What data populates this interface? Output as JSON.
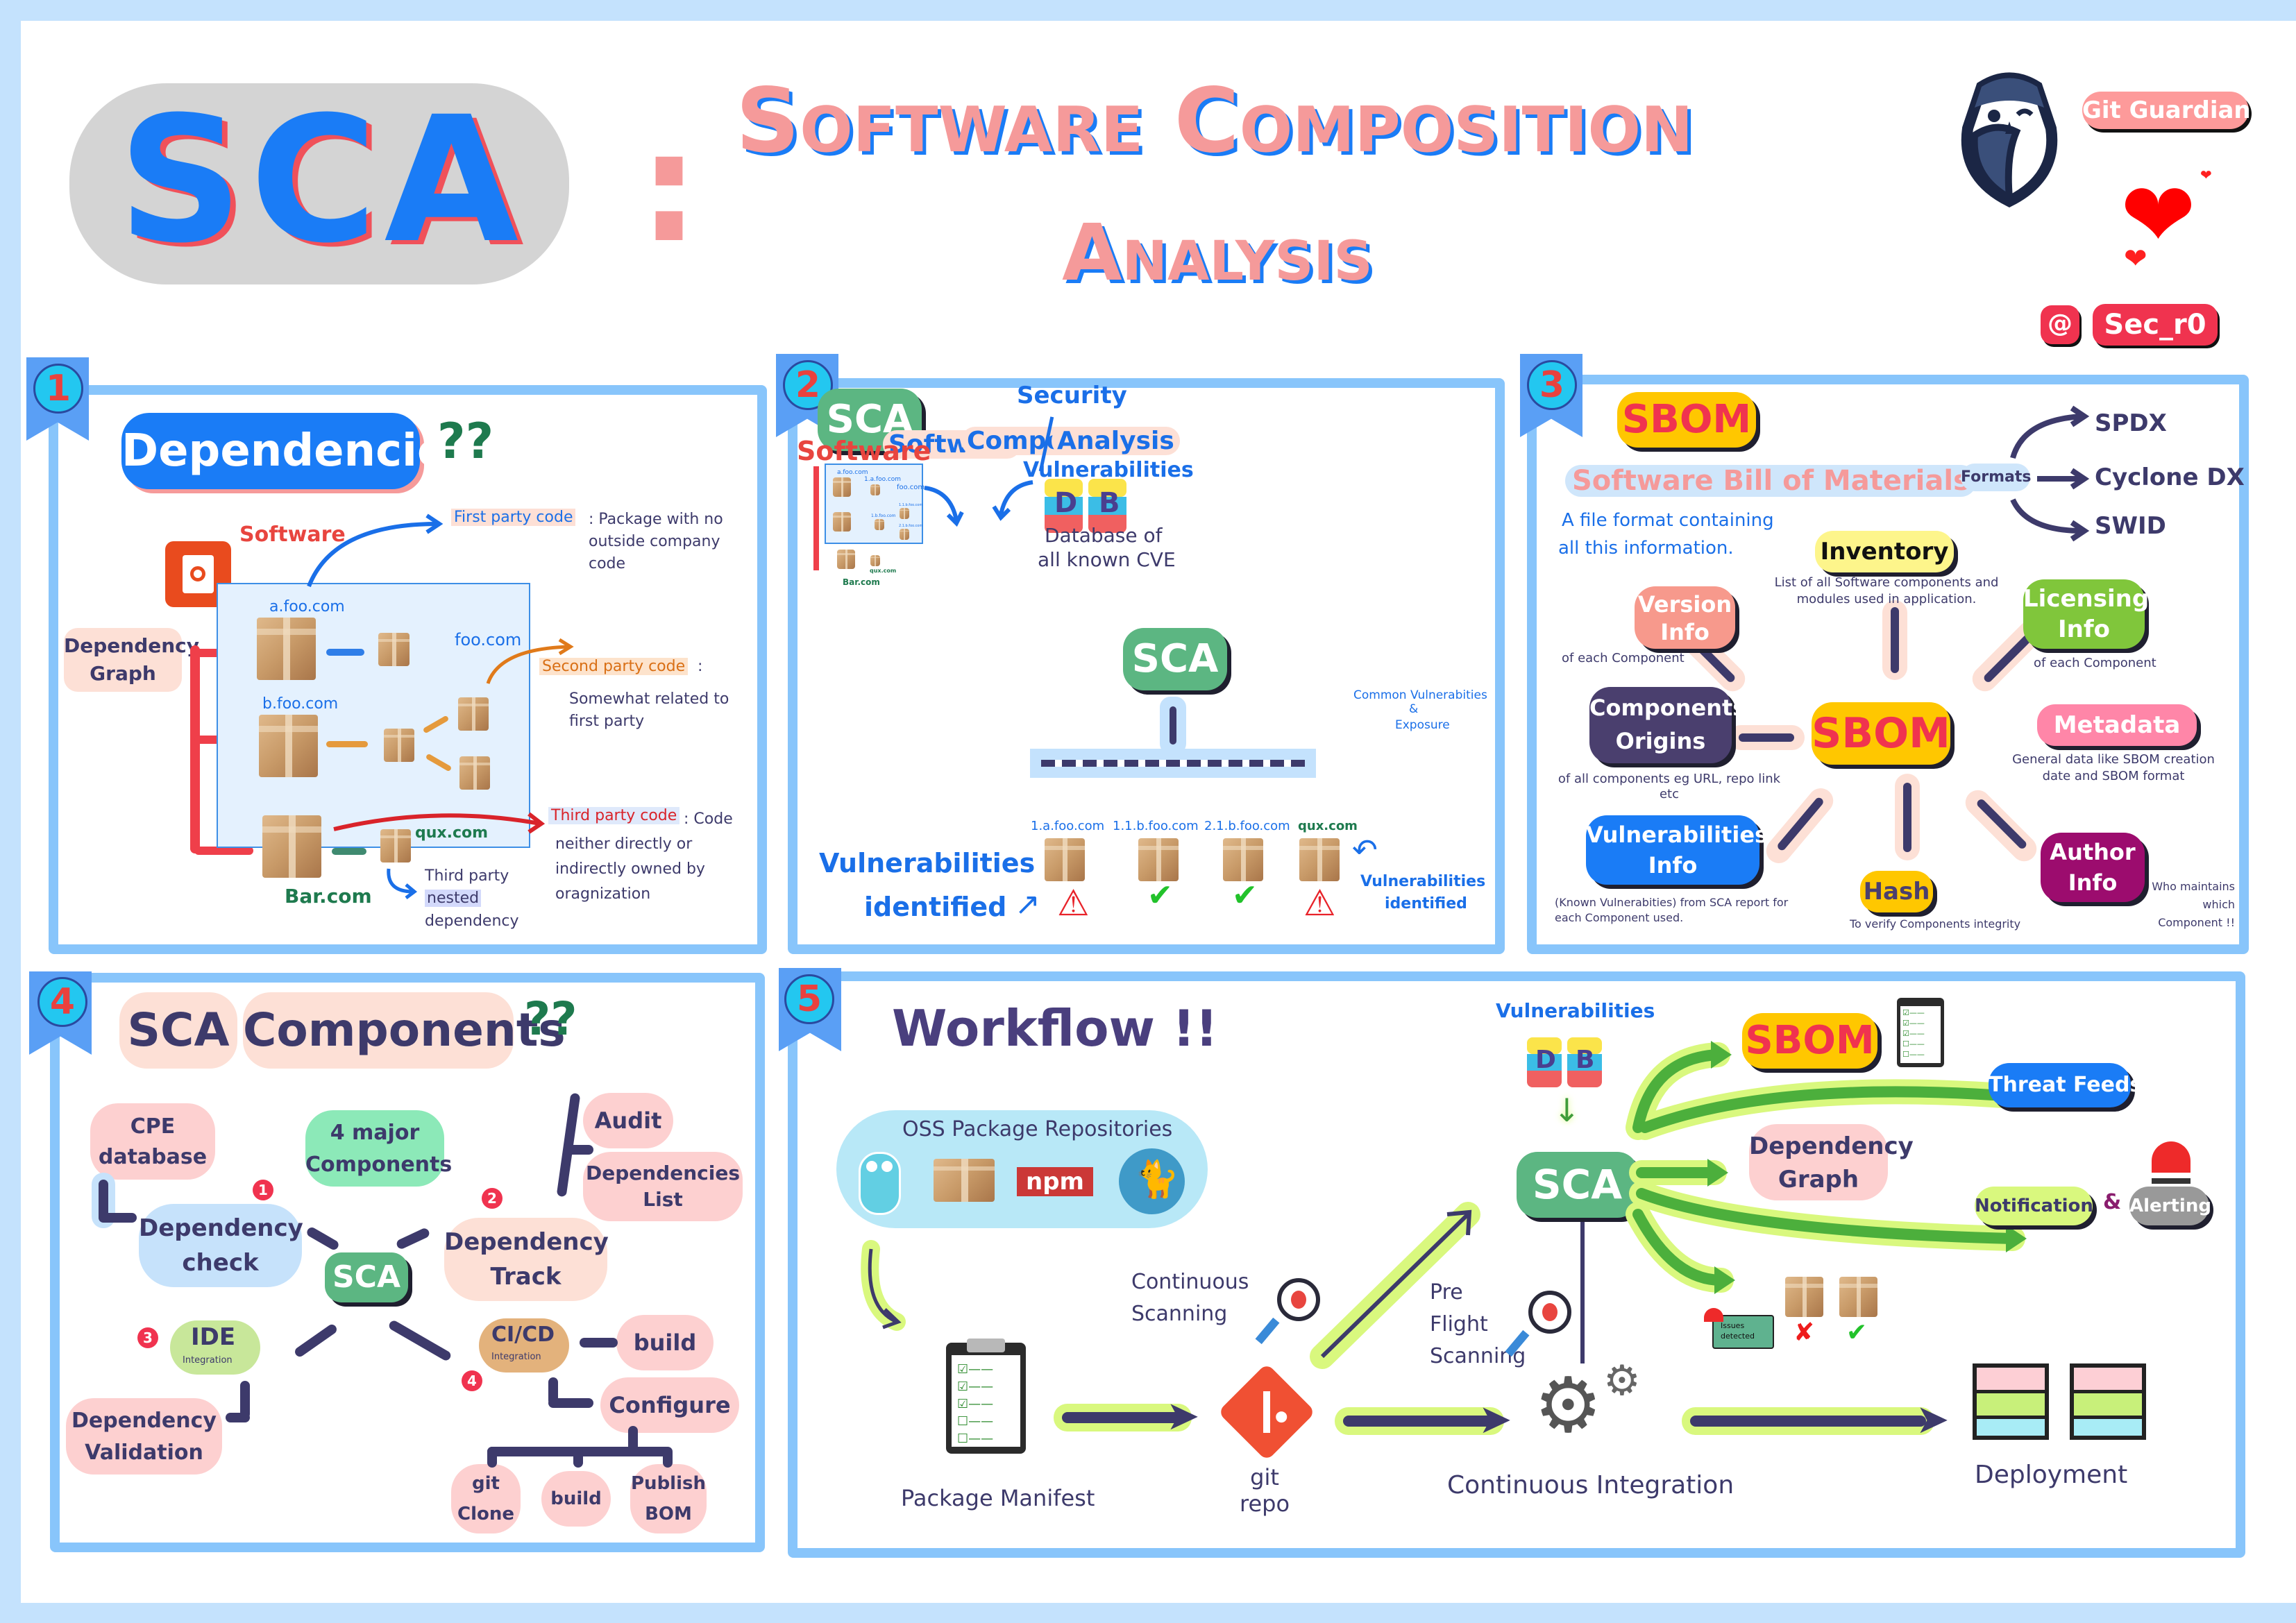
{
  "header": {
    "acronym": "SCA",
    "colon": ":",
    "title_line1": "Software Composition",
    "title_line2": "Analysis",
    "brand": "Git Guardian",
    "handle_at": "@",
    "handle": "Sec_r0"
  },
  "colors": {
    "page_bg": "#c4e2fd",
    "panel_border": "#88c5fb",
    "title_pink": "#f59a9a",
    "title_blue": "#1a7cf6",
    "sca_green": "#5cb682",
    "sbom_yellow": "#ffc700",
    "sbom_red": "#f0334f",
    "ink": "#3d3a6b"
  },
  "panel1": {
    "number": "1",
    "title": "Dependencies",
    "title_suffix": "??",
    "software_label": "Software",
    "graph_label": "Dependency Graph",
    "nodes": {
      "a_foo": "a.foo.com",
      "b_foo": "b.foo.com",
      "foo": "foo.com",
      "qux": "qux.com",
      "bar": "Bar.com"
    },
    "first_party": {
      "term": "First party code",
      "desc": ": Package with no outside company code"
    },
    "second_party": {
      "term": "Second party code",
      "desc_prefix": ":",
      "desc": "Somewhat related to first party"
    },
    "third_party": {
      "term": "Third party code",
      "desc": ": Code neither directly or indirectly owned by oragnization"
    },
    "nested": {
      "line1": "Third party",
      "highlight": "nested",
      "line3": "dependency"
    }
  },
  "panel2": {
    "number": "2",
    "badge": "SCA",
    "expansion": {
      "software": "Software",
      "composition": "Composition",
      "analysis": "Analysis",
      "alt": "Security"
    },
    "software_label": "Software",
    "mini_nodes": {
      "a_foo": "a.foo.com",
      "a1": "1.a.foo.com",
      "foo": "foo.com",
      "b1": "1.b.foo.com",
      "b11": "1.1.b.foo.com",
      "b21": "2.1.b.foo.com",
      "qux": "qux.com",
      "bar": "Bar.com"
    },
    "vuln_label": "Vulnerabilities",
    "db_letters": [
      "D",
      "B"
    ],
    "db_caption_line1": "Database of",
    "db_caption_line2": "all known CVE",
    "cve_expansion": [
      "Common Vulnerabities",
      "&",
      "Exposure"
    ],
    "center": "SCA",
    "results": [
      {
        "name": "1.a.foo.com",
        "status": "vulnerable"
      },
      {
        "name": "1.1.b.foo.com",
        "status": "ok"
      },
      {
        "name": "2.1.b.foo.com",
        "status": "ok"
      },
      {
        "name": "qux.com",
        "status": "vulnerable"
      }
    ],
    "identified_left": [
      "Vulnerabilities",
      "identified"
    ],
    "identified_right": [
      "Vulnerabilities",
      "identified"
    ]
  },
  "panel3": {
    "number": "3",
    "badge": "SBOM",
    "expansion": "Software Bill of Materials",
    "desc": [
      "A file format containing",
      "all this information."
    ],
    "formats_label": "Formats",
    "formats": [
      "SPDX",
      "Cyclone DX",
      "SWID"
    ],
    "center": "SBOM",
    "items": [
      {
        "key": "inventory",
        "label": "Inventory",
        "desc": "List of all Software components and modules used in application."
      },
      {
        "key": "version",
        "label": "Version Info",
        "desc": "of each Component"
      },
      {
        "key": "licensing",
        "label": "Licensing Info",
        "desc": "of each Component"
      },
      {
        "key": "origins",
        "label": "Components Origins",
        "desc": "of all components eg URL, repo link etc"
      },
      {
        "key": "metadata",
        "label": "Metadata",
        "desc": "General data like SBOM creation date and SBOM format"
      },
      {
        "key": "vulns",
        "label": "Vulnerabilities Info",
        "desc": "(Known Vulnerabities) from SCA report for each Component used."
      },
      {
        "key": "hash",
        "label": "Hash",
        "desc": "To verify Components integrity"
      },
      {
        "key": "author",
        "label": "Author Info",
        "desc": "Who maintains which Component !!"
      }
    ]
  },
  "panel4": {
    "number": "4",
    "title_a": "SCA",
    "title_b": "Components",
    "title_suffix": "??",
    "center": "SCA",
    "summary": "4 major Components",
    "components": [
      {
        "n": "1",
        "label": "Dependency check",
        "children": [
          "CPE database"
        ]
      },
      {
        "n": "2",
        "label": "Dependency Track",
        "children": [
          "Audit",
          "Dependencies List"
        ]
      },
      {
        "n": "3",
        "label": "IDE",
        "sub": "Integration",
        "children": [
          "Dependency Validation"
        ]
      },
      {
        "n": "4",
        "label": "CI/CD",
        "sub": "Integration",
        "children": [
          "build",
          "Configure"
        ]
      }
    ],
    "configure_children": [
      "git Clone",
      "build",
      "Publish BOM"
    ]
  },
  "panel5": {
    "number": "5",
    "title": "Workflow !!",
    "repos_label": "OSS Package Repositories",
    "repos": [
      "go-gopher",
      "package-box",
      "npm",
      "yarn-cat"
    ],
    "npm_text": "npm",
    "manifest": "Package Manifest",
    "git_repo": "git repo",
    "continuous_scanning": "Continuous Scanning",
    "preflight": "Pre Flight Scanning",
    "ci": "Continuous Integration",
    "vuln_label": "Vulnerabilities",
    "db_letters": [
      "D",
      "B"
    ],
    "center": "SCA",
    "outputs": {
      "sbom": "SBOM",
      "threat_feeds": "Threat Feeds",
      "dep_graph": "Dependency Graph",
      "notification": "Notification",
      "amp": "&",
      "alerting": "Alerting",
      "issues": "Issues detected"
    },
    "deployment": "Deployment"
  }
}
